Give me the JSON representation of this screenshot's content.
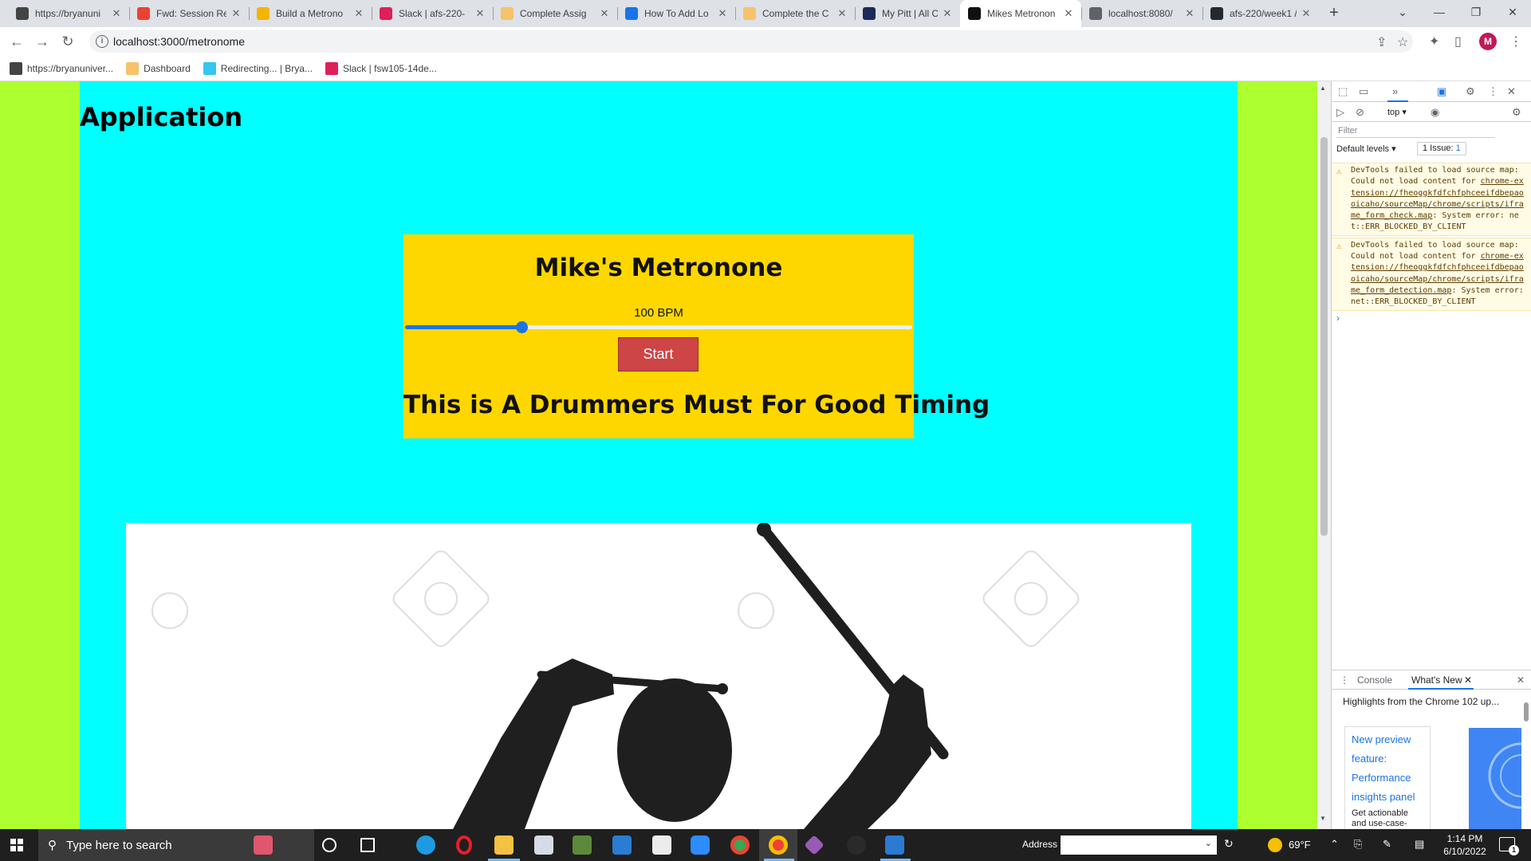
{
  "browser": {
    "tabs": [
      {
        "title": "https://bryanuni",
        "favicon_color": "#444444"
      },
      {
        "title": "Fwd: Session Re",
        "favicon_color": "#ea4335"
      },
      {
        "title": "Build a Metrono",
        "favicon_color": "#f4b400"
      },
      {
        "title": "Slack | afs-220-",
        "favicon_color": "#e01e5a"
      },
      {
        "title": "Complete Assig",
        "favicon_color": "#f6c26b"
      },
      {
        "title": "How To Add Lo",
        "favicon_color": "#1a73e8"
      },
      {
        "title": "Complete the C",
        "favicon_color": "#f6c26b"
      },
      {
        "title": "My Pitt | All Can",
        "favicon_color": "#1c2a5a"
      },
      {
        "title": "Mikes Metronon",
        "favicon_color": "#111111",
        "active": true
      },
      {
        "title": "localhost:8080/",
        "favicon_color": "#5f6368"
      },
      {
        "title": "afs-220/week1 /",
        "favicon_color": "#24292f"
      }
    ],
    "new_tab_label": "+",
    "url": "localhost:3000/metronome",
    "profile_initial": "M",
    "bookmarks": [
      {
        "label": "https://bryanuniver...",
        "favicon_color": "#444444"
      },
      {
        "label": "Dashboard",
        "favicon_color": "#f6c26b"
      },
      {
        "label": "Redirecting... | Brya...",
        "favicon_color": "#36c5f0"
      },
      {
        "label": "Slack | fsw105-14de...",
        "favicon_color": "#e01e5a"
      }
    ]
  },
  "page": {
    "heading": "Application",
    "background_color": "#adff2f",
    "app_background_color": "#00ffff",
    "metronome": {
      "title": "Mike's Metronone",
      "bpm_label": "100 BPM",
      "bpm_value": 100,
      "slider_fraction": 0.23,
      "start_label": "Start",
      "tagline": "This is A Drummers Must For Good Timing",
      "panel_color": "#ffd700",
      "button_color": "#cd4545"
    }
  },
  "devtools": {
    "context": "top",
    "filter_placeholder": "Filter",
    "levels": "Default levels",
    "issues_label": "1 Issue:",
    "issues_count": "1",
    "messages": [
      {
        "prefix": "DevTools failed to load source map: Could not load content for ",
        "link": "chrome-extension://fheoggkfdfchfphceeifdbepaooicaho/sourceMap/chrome/scripts/iframe_form_check.map",
        "suffix": ": System error: net::ERR_BLOCKED_BY_CLIENT"
      },
      {
        "prefix": "DevTools failed to load source map: Could not load content for ",
        "link": "chrome-extension://fheoggkfdfchfphceeifdbepaooicaho/sourceMap/chrome/scripts/iframe_form_detection.map",
        "suffix": ": System error: net::ERR_BLOCKED_BY_CLIENT"
      }
    ],
    "prompt": "›",
    "drawer": {
      "tab_console": "Console",
      "tab_whats_new": "What's New",
      "highlights": "Highlights from the Chrome 102 up...",
      "card_title": "New preview feature: Performance insights panel",
      "card_body": "Get actionable and use-case-driven insights"
    }
  },
  "taskbar": {
    "search_placeholder": "Type here to search",
    "address_label": "Address",
    "weather": "69°F",
    "time": "1:14 PM",
    "date": "6/10/2022",
    "notification_count": "1"
  }
}
